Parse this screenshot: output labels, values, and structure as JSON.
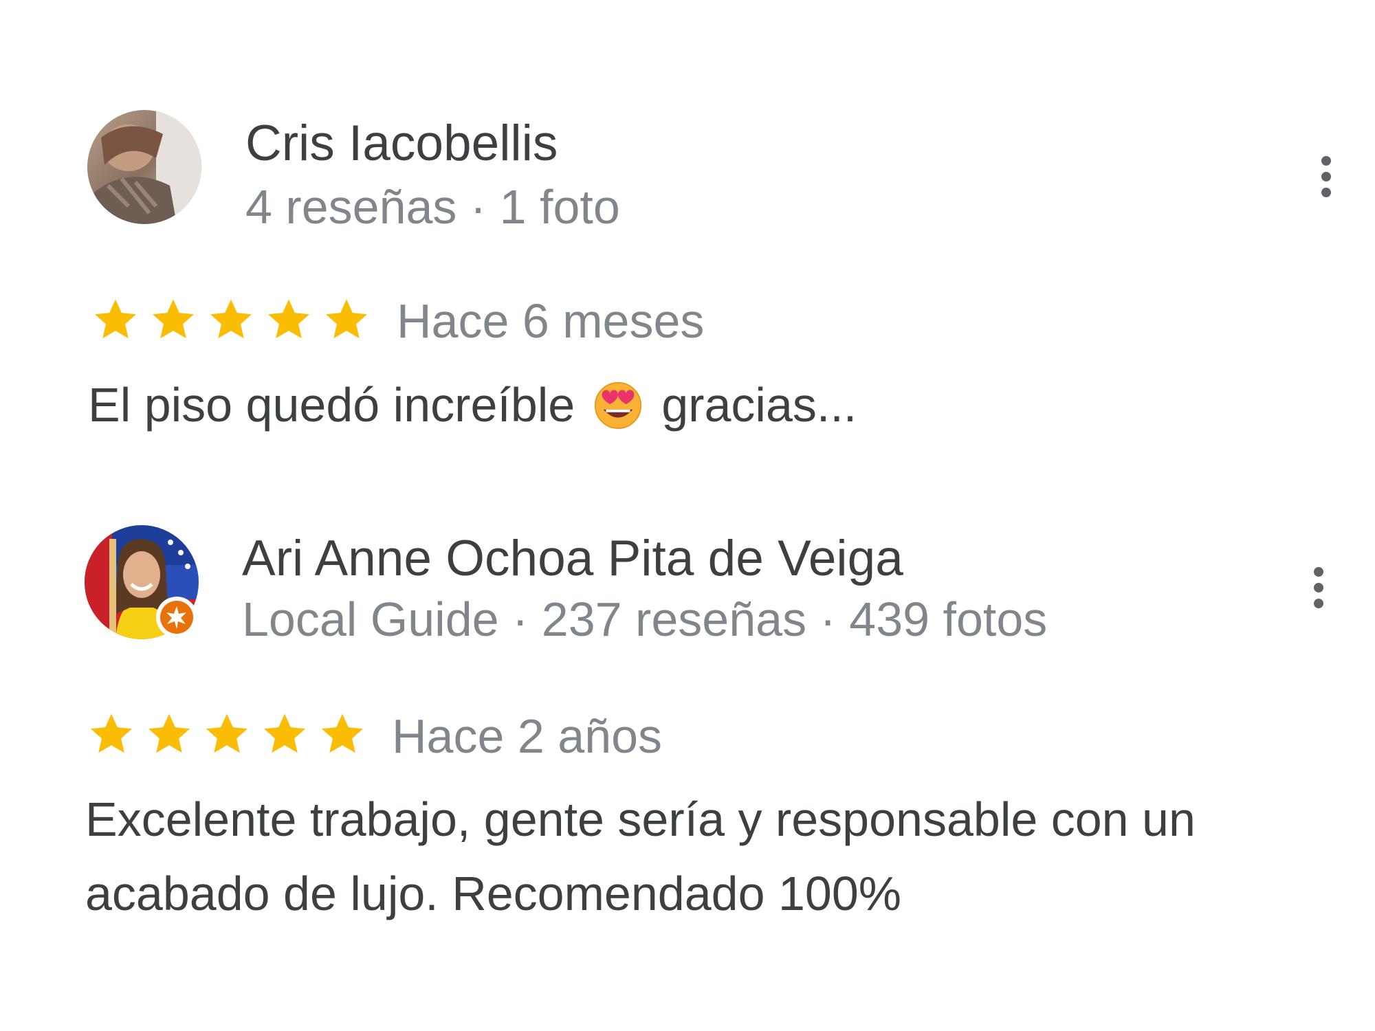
{
  "reviews": [
    {
      "author": "Cris Iacobellis",
      "meta": "4 reseñas · 1 foto",
      "rating": 5,
      "date": "Hace 6 meses",
      "text_before": "El piso quedó increíble",
      "emoji": "smiling-face-with-heart-eyes",
      "text_after": "gracias...",
      "avatar_icon": "user-photo-avatar"
    },
    {
      "author": "Ari Anne Ochoa Pita de Veiga",
      "meta": "Local Guide · 237 reseñas · 439 fotos",
      "rating": 5,
      "date": "Hace 2 años",
      "text_line1": "Excelente trabajo, gente sería y responsable con un",
      "text_line2": "acabado de lujo. Recomendado 100%",
      "avatar_icon": "user-photo-avatar",
      "badge_icon": "local-guide-badge-icon"
    }
  ],
  "colors": {
    "star": "#fbbc04",
    "meta": "#80868b",
    "text": "#3c4043",
    "badge": "#e8710a"
  }
}
